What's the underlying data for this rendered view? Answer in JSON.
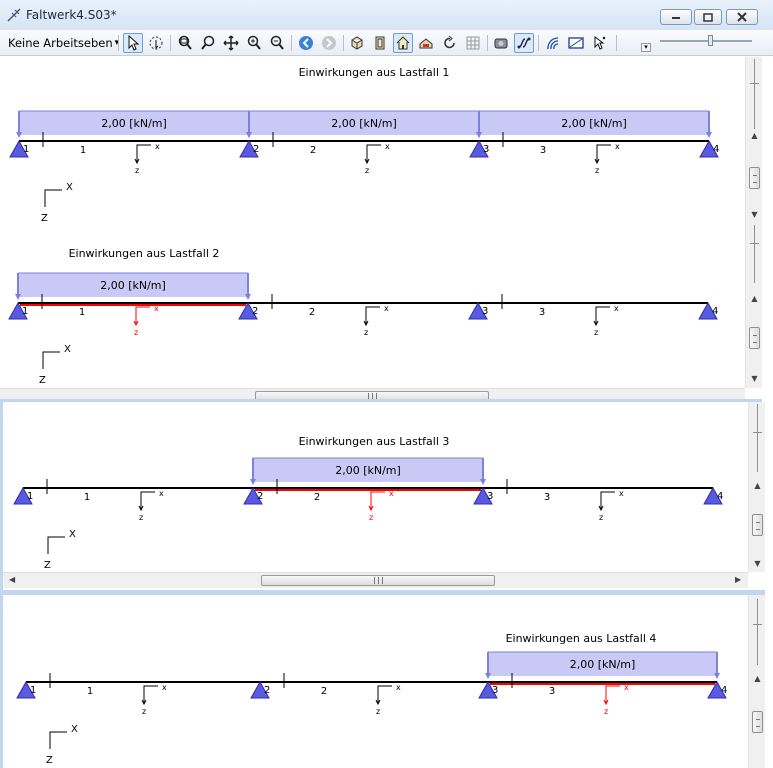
{
  "window": {
    "title": "Faltwerk4.S03*",
    "minimize_icon": "minimize-icon",
    "maximize_icon": "maximize-icon",
    "close_icon": "close-icon"
  },
  "toolbar": {
    "layer_select": "Keine Arbeitseben",
    "tools": [
      "select-arrow-icon",
      "pick-icon",
      "zoom-window-icon",
      "zoom-icon",
      "pan-icon",
      "zoom-in-icon",
      "zoom-out-icon",
      "back-icon",
      "forward-icon",
      "cube-icon",
      "front-view-icon",
      "home-view-icon",
      "section-view-icon",
      "rotate-icon",
      "grid-icon",
      "render-icon",
      "link-icon",
      "node-icon",
      "image-icon",
      "cursor-icon"
    ]
  },
  "panels": [
    {
      "heading": "Einwirkungen aus Lastfall 1",
      "loads": [
        "2,00 [kN/m]",
        "2,00 [kN/m]",
        "2,00 [kN/m]"
      ],
      "nodes": [
        "1",
        "2",
        "3",
        "4"
      ],
      "members": [
        "1",
        "2",
        "3"
      ],
      "loaded_members": [],
      "local_axis": {
        "x": "x",
        "z": "z"
      },
      "global_axis": {
        "x": "X",
        "z": "Z"
      }
    },
    {
      "heading": "Einwirkungen aus Lastfall 2",
      "loads": [
        "2,00 [kN/m]"
      ],
      "nodes": [
        "1",
        "2",
        "3",
        "4"
      ],
      "members": [
        "1",
        "2",
        "3"
      ],
      "loaded_members": [
        1
      ],
      "local_axis": {
        "x": "x",
        "z": "z"
      },
      "global_axis": {
        "x": "X",
        "z": "Z"
      }
    },
    {
      "heading": "Einwirkungen aus Lastfall 3",
      "loads": [
        "2,00 [kN/m]"
      ],
      "nodes": [
        "1",
        "2",
        "3",
        "4"
      ],
      "members": [
        "1",
        "2",
        "3"
      ],
      "loaded_members": [
        2
      ],
      "local_axis": {
        "x": "x",
        "z": "z"
      },
      "global_axis": {
        "x": "X",
        "z": "Z"
      }
    },
    {
      "heading": "Einwirkungen aus Lastfall 4",
      "loads": [
        "2,00 [kN/m]"
      ],
      "nodes": [
        "1",
        "2",
        "3",
        "4"
      ],
      "members": [
        "1",
        "2",
        "3"
      ],
      "loaded_members": [
        3
      ],
      "local_axis": {
        "x": "x",
        "z": "z"
      },
      "global_axis": {
        "x": "X",
        "z": "Z"
      }
    }
  ],
  "colors": {
    "load_fill": "#c9c9f5",
    "load_stroke": "#7f7fe0",
    "support_fill": "#5a5ae0",
    "beam": "#000000",
    "loaded_beam": "#ff0000",
    "title_bar": "#dae6f3"
  }
}
